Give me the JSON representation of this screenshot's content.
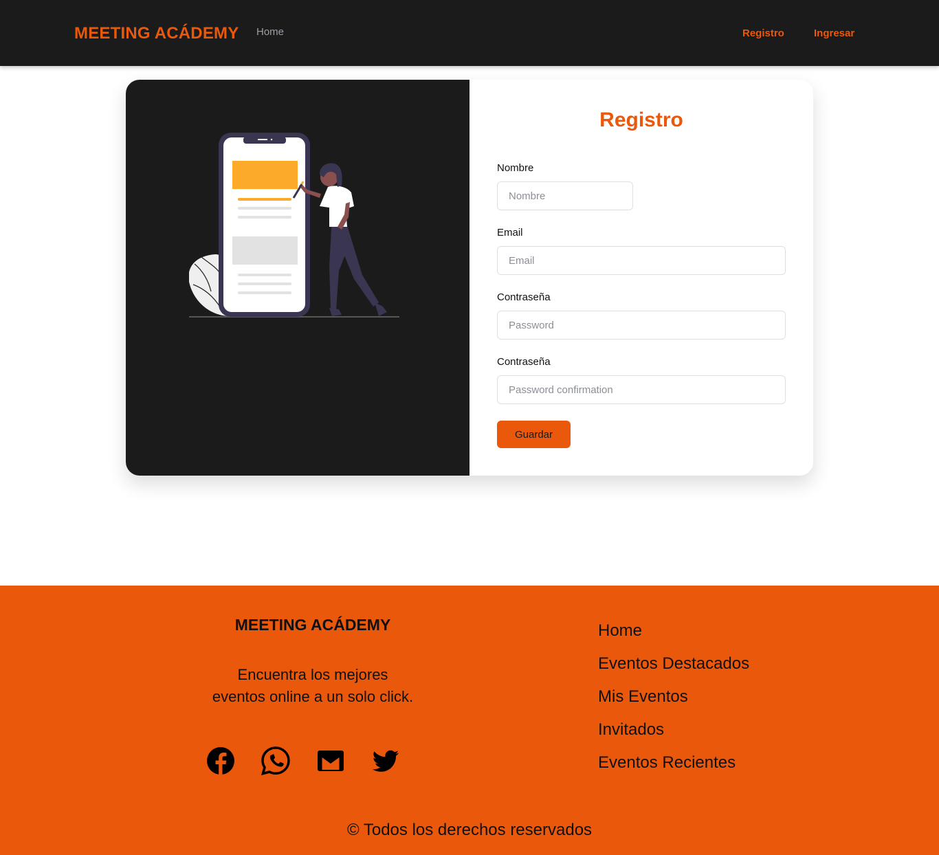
{
  "nav": {
    "brand": "MEETING ACÁDEMY",
    "home": "Home",
    "registro": "Registro",
    "ingresar": "Ingresar"
  },
  "form": {
    "title": "Registro",
    "name_label": "Nombre",
    "name_placeholder": "Nombre",
    "email_label": "Email",
    "email_placeholder": "Email",
    "password_label": "Contraseña",
    "password_placeholder": "Password",
    "confirm_label": "Contraseña",
    "confirm_placeholder": "Password confirmation",
    "save_label": "Guardar"
  },
  "footer": {
    "brand": "MEETING ACÁDEMY",
    "tagline_line1": "Encuentra los mejores",
    "tagline_line2": "eventos online a un solo click.",
    "social_icons": [
      "facebook-icon",
      "whatsapp-icon",
      "gmail-icon",
      "twitter-icon"
    ],
    "links": [
      "Home",
      "Eventos Destacados",
      "Mis Eventos",
      "Invitados",
      "Eventos Recientes"
    ],
    "copyright": "© Todos los derechos reservados"
  },
  "colors": {
    "accent": "#ea580c",
    "dark": "#1b1b1c",
    "illustration_yellow": "#fbab29"
  }
}
